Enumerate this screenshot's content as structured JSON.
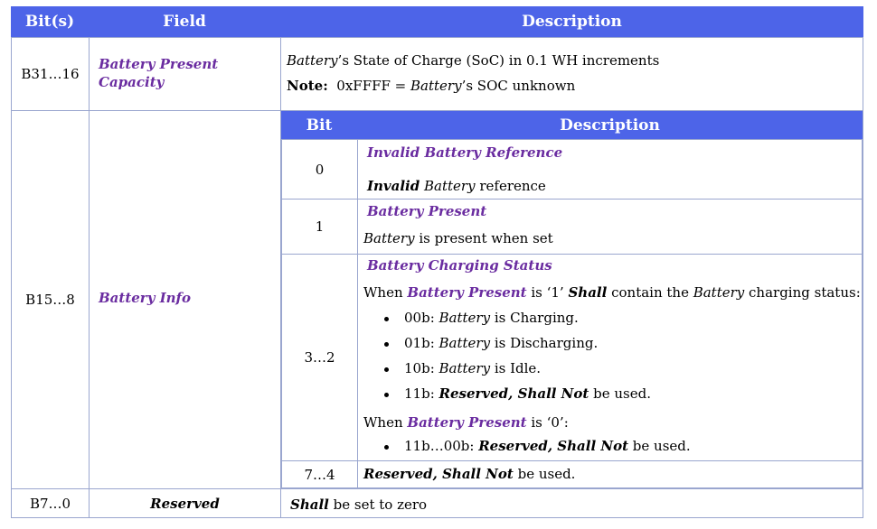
{
  "header": {
    "bits": "Bit(s)",
    "field": "Field",
    "description": "Description"
  },
  "row1": {
    "bits": "B31…16",
    "field_line1": "Battery Present",
    "field_line2": "Capacity",
    "desc1": {
      "a": "Battery",
      "b": "’s State of Charge (SoC) in 0.1 WH increments"
    },
    "note": {
      "label": "Note:",
      "a": "0xFFFF = ",
      "b": "Battery",
      "c": "’s SOC unknown"
    }
  },
  "row2": {
    "bits": "B15…8",
    "field": "Battery Info",
    "sub_header": {
      "bit": "Bit",
      "description": "Description"
    },
    "sub0": {
      "bit": "0",
      "title": "Invalid Battery Reference",
      "a": "Invalid",
      "b": "Battery",
      "c": " reference"
    },
    "sub1": {
      "bit": "1",
      "title": "Battery Present",
      "a": "Battery",
      "b": " is present when set"
    },
    "sub32": {
      "bit": "3…2",
      "title": "Battery Charging Status",
      "when1": {
        "a": "When ",
        "b": "Battery Present",
        "c": " is ‘1’ ",
        "d": "Shall",
        "e": " contain the ",
        "f": "Battery",
        "g": " charging status:"
      },
      "items": [
        {
          "a": "00b: ",
          "b": "Battery",
          "c": " is Charging."
        },
        {
          "a": "01b: ",
          "b": "Battery",
          "c": " is Discharging."
        },
        {
          "a": "10b: ",
          "b": "Battery",
          "c": " is Idle."
        },
        {
          "a": "11b: ",
          "b": "Reserved, Shall Not",
          "c": " be used."
        }
      ],
      "when0": {
        "a": "When ",
        "b": "Battery Present",
        "c": " is ‘0’:"
      },
      "item_last": {
        "a": "11b…00b: ",
        "b": "Reserved, Shall Not",
        "c": " be used."
      }
    },
    "sub74": {
      "bit": "7…4",
      "a": "Reserved, Shall Not",
      "b": " be used."
    }
  },
  "row3": {
    "bits": "B7…0",
    "field": "Reserved",
    "a": "Shall",
    "b": " be set to zero"
  }
}
